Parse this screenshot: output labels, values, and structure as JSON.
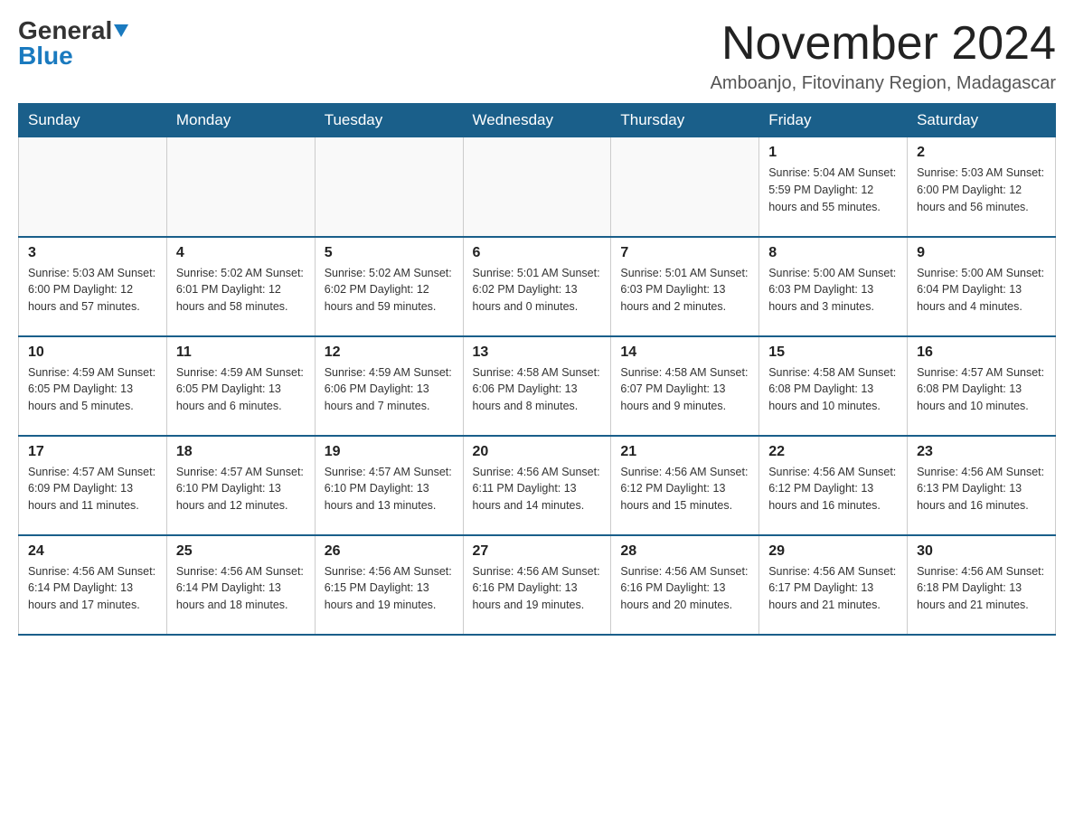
{
  "logo": {
    "text_general": "General",
    "text_blue": "Blue"
  },
  "title": "November 2024",
  "subtitle": "Amboanjo, Fitovinany Region, Madagascar",
  "days_of_week": [
    "Sunday",
    "Monday",
    "Tuesday",
    "Wednesday",
    "Thursday",
    "Friday",
    "Saturday"
  ],
  "weeks": [
    [
      {
        "day": "",
        "info": ""
      },
      {
        "day": "",
        "info": ""
      },
      {
        "day": "",
        "info": ""
      },
      {
        "day": "",
        "info": ""
      },
      {
        "day": "",
        "info": ""
      },
      {
        "day": "1",
        "info": "Sunrise: 5:04 AM\nSunset: 5:59 PM\nDaylight: 12 hours\nand 55 minutes."
      },
      {
        "day": "2",
        "info": "Sunrise: 5:03 AM\nSunset: 6:00 PM\nDaylight: 12 hours\nand 56 minutes."
      }
    ],
    [
      {
        "day": "3",
        "info": "Sunrise: 5:03 AM\nSunset: 6:00 PM\nDaylight: 12 hours\nand 57 minutes."
      },
      {
        "day": "4",
        "info": "Sunrise: 5:02 AM\nSunset: 6:01 PM\nDaylight: 12 hours\nand 58 minutes."
      },
      {
        "day": "5",
        "info": "Sunrise: 5:02 AM\nSunset: 6:02 PM\nDaylight: 12 hours\nand 59 minutes."
      },
      {
        "day": "6",
        "info": "Sunrise: 5:01 AM\nSunset: 6:02 PM\nDaylight: 13 hours\nand 0 minutes."
      },
      {
        "day": "7",
        "info": "Sunrise: 5:01 AM\nSunset: 6:03 PM\nDaylight: 13 hours\nand 2 minutes."
      },
      {
        "day": "8",
        "info": "Sunrise: 5:00 AM\nSunset: 6:03 PM\nDaylight: 13 hours\nand 3 minutes."
      },
      {
        "day": "9",
        "info": "Sunrise: 5:00 AM\nSunset: 6:04 PM\nDaylight: 13 hours\nand 4 minutes."
      }
    ],
    [
      {
        "day": "10",
        "info": "Sunrise: 4:59 AM\nSunset: 6:05 PM\nDaylight: 13 hours\nand 5 minutes."
      },
      {
        "day": "11",
        "info": "Sunrise: 4:59 AM\nSunset: 6:05 PM\nDaylight: 13 hours\nand 6 minutes."
      },
      {
        "day": "12",
        "info": "Sunrise: 4:59 AM\nSunset: 6:06 PM\nDaylight: 13 hours\nand 7 minutes."
      },
      {
        "day": "13",
        "info": "Sunrise: 4:58 AM\nSunset: 6:06 PM\nDaylight: 13 hours\nand 8 minutes."
      },
      {
        "day": "14",
        "info": "Sunrise: 4:58 AM\nSunset: 6:07 PM\nDaylight: 13 hours\nand 9 minutes."
      },
      {
        "day": "15",
        "info": "Sunrise: 4:58 AM\nSunset: 6:08 PM\nDaylight: 13 hours\nand 10 minutes."
      },
      {
        "day": "16",
        "info": "Sunrise: 4:57 AM\nSunset: 6:08 PM\nDaylight: 13 hours\nand 10 minutes."
      }
    ],
    [
      {
        "day": "17",
        "info": "Sunrise: 4:57 AM\nSunset: 6:09 PM\nDaylight: 13 hours\nand 11 minutes."
      },
      {
        "day": "18",
        "info": "Sunrise: 4:57 AM\nSunset: 6:10 PM\nDaylight: 13 hours\nand 12 minutes."
      },
      {
        "day": "19",
        "info": "Sunrise: 4:57 AM\nSunset: 6:10 PM\nDaylight: 13 hours\nand 13 minutes."
      },
      {
        "day": "20",
        "info": "Sunrise: 4:56 AM\nSunset: 6:11 PM\nDaylight: 13 hours\nand 14 minutes."
      },
      {
        "day": "21",
        "info": "Sunrise: 4:56 AM\nSunset: 6:12 PM\nDaylight: 13 hours\nand 15 minutes."
      },
      {
        "day": "22",
        "info": "Sunrise: 4:56 AM\nSunset: 6:12 PM\nDaylight: 13 hours\nand 16 minutes."
      },
      {
        "day": "23",
        "info": "Sunrise: 4:56 AM\nSunset: 6:13 PM\nDaylight: 13 hours\nand 16 minutes."
      }
    ],
    [
      {
        "day": "24",
        "info": "Sunrise: 4:56 AM\nSunset: 6:14 PM\nDaylight: 13 hours\nand 17 minutes."
      },
      {
        "day": "25",
        "info": "Sunrise: 4:56 AM\nSunset: 6:14 PM\nDaylight: 13 hours\nand 18 minutes."
      },
      {
        "day": "26",
        "info": "Sunrise: 4:56 AM\nSunset: 6:15 PM\nDaylight: 13 hours\nand 19 minutes."
      },
      {
        "day": "27",
        "info": "Sunrise: 4:56 AM\nSunset: 6:16 PM\nDaylight: 13 hours\nand 19 minutes."
      },
      {
        "day": "28",
        "info": "Sunrise: 4:56 AM\nSunset: 6:16 PM\nDaylight: 13 hours\nand 20 minutes."
      },
      {
        "day": "29",
        "info": "Sunrise: 4:56 AM\nSunset: 6:17 PM\nDaylight: 13 hours\nand 21 minutes."
      },
      {
        "day": "30",
        "info": "Sunrise: 4:56 AM\nSunset: 6:18 PM\nDaylight: 13 hours\nand 21 minutes."
      }
    ]
  ]
}
